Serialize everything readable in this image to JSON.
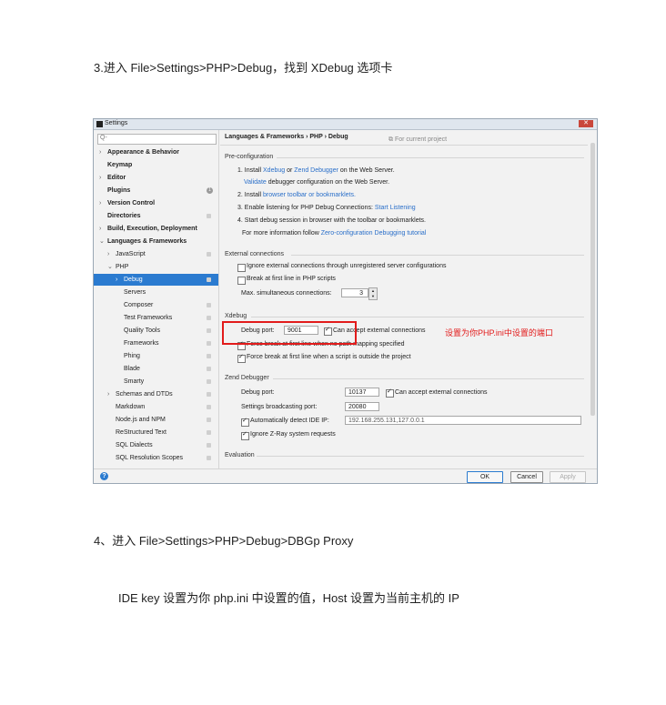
{
  "doc": {
    "step3": "3.进入 File>Settings>PHP>Debug，找到 XDebug 选项卡",
    "step4": "4、进入 File>Settings>PHP>Debug>DBGp Proxy",
    "note": "IDE key 设置为你 php.ini 中设置的值，Host 设置为当前主机的 IP"
  },
  "window": {
    "title": "Settings",
    "close_label": "✕"
  },
  "sidebar": {
    "search_placeholder": "Q-",
    "items": [
      {
        "label": "Appearance & Behavior",
        "arrow": "›",
        "bold": true
      },
      {
        "label": "Keymap",
        "bold": true
      },
      {
        "label": "Editor",
        "arrow": "›",
        "bold": true
      },
      {
        "label": "Plugins",
        "bold": true,
        "badge": "1"
      },
      {
        "label": "Version Control",
        "arrow": "›",
        "bold": true
      },
      {
        "label": "Directories",
        "bold": true
      },
      {
        "label": "Build, Execution, Deployment",
        "arrow": "›",
        "bold": true
      },
      {
        "label": "Languages & Frameworks",
        "arrow": "⌄",
        "bold": true
      },
      {
        "label": "JavaScript",
        "arrow": "›"
      },
      {
        "label": "PHP",
        "arrow": "⌄"
      },
      {
        "label": "Debug",
        "arrow": "›",
        "selected": true
      },
      {
        "label": "Servers"
      },
      {
        "label": "Composer"
      },
      {
        "label": "Test Frameworks"
      },
      {
        "label": "Quality Tools"
      },
      {
        "label": "Frameworks"
      },
      {
        "label": "Phing"
      },
      {
        "label": "Blade"
      },
      {
        "label": "Smarty"
      },
      {
        "label": "Schemas and DTDs",
        "arrow": "›"
      },
      {
        "label": "Markdown"
      },
      {
        "label": "Node.js and NPM"
      },
      {
        "label": "ReStructured Text"
      },
      {
        "label": "SQL Dialects"
      },
      {
        "label": "SQL Resolution Scopes"
      }
    ]
  },
  "content": {
    "breadcrumb": "Languages & Frameworks  ›  PHP  ›  Debug",
    "for_project": "⧉ For current project",
    "preconfig": {
      "title": "Pre-configuration",
      "step1_a": "1. Install ",
      "step1_xdebug": "Xdebug",
      "step1_or": " or ",
      "step1_zend": "Zend Debugger",
      "step1_b": " on the Web Server.",
      "validate": "Validate",
      "validate_rest": " debugger configuration on the Web Server.",
      "step2_a": "2. Install ",
      "step2_link": "browser toolbar or bookmarklets.",
      "step3_a": "3. Enable listening for PHP Debug Connections:  ",
      "step3_link": "Start Listening",
      "step4": "4. Start debug session in browser with the toolbar or bookmarklets.",
      "more_a": "For more information follow  ",
      "more_link": "Zero-configuration Debugging tutorial"
    },
    "external": {
      "title": "External connections",
      "ignore": "Ignore external connections through unregistered server configurations",
      "break_first": "Break at first line in PHP scripts",
      "max_label": "Max. simultaneous connections:",
      "max_value": "3"
    },
    "xdebug": {
      "title": "Xdebug",
      "port_label": "Debug port:",
      "port_value": "9001",
      "accept": "Can accept external connections",
      "force_nomap": "Force break at first line when no path mapping specified",
      "force_outside": "Force break at first line when a script is outside the project"
    },
    "zend": {
      "title": "Zend Debugger",
      "port_label": "Debug port:",
      "port_value": "10137",
      "accept": "Can accept external connections",
      "broadcast_label": "Settings broadcasting port:",
      "broadcast_value": "20080",
      "auto_ip": "Automatically detect IDE IP:",
      "ip_value": "192.168.255.131,127.0.0.1",
      "ignore_zray": "Ignore Z-Ray system requests"
    },
    "evaluation": {
      "title": "Evaluation"
    }
  },
  "buttons": {
    "ok": "OK",
    "cancel": "Cancel",
    "apply": "Apply",
    "help": "?"
  },
  "annotation": "设置为你PHP.ini中设置的端口",
  "colors": {
    "annotation": "#e21b1b",
    "selection": "#2b7bd0",
    "link": "#2a6fc9"
  }
}
